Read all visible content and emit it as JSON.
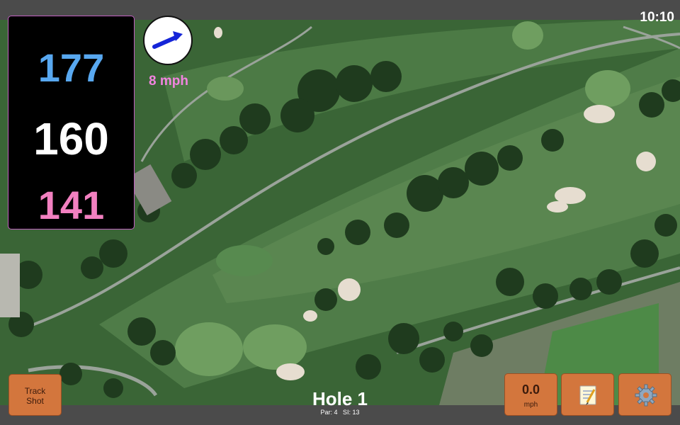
{
  "status": {
    "time": "10:10"
  },
  "distances": {
    "back": "177",
    "center": "160",
    "front": "141"
  },
  "wind": {
    "speed": "8 mph",
    "direction_icon": "arrow-right-icon"
  },
  "hole": {
    "title": "Hole 1",
    "par": "Par: 4",
    "stroke_index": "SI: 13"
  },
  "buttons": {
    "track_shot": "Track\nShot",
    "speed_value": "0.0",
    "speed_unit": "mph",
    "notes_icon": "notepad-icon",
    "settings_icon": "gear-icon"
  },
  "colors": {
    "back": "#58a8f0",
    "center": "#ffffff",
    "front": "#f280c0",
    "button": "#d3763d",
    "wind_text": "#f284e0"
  }
}
